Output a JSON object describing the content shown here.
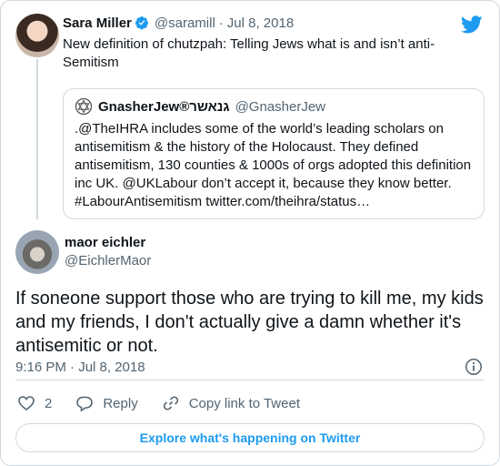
{
  "parent_tweet": {
    "author_name": "Sara Miller",
    "author_handle": "@saramill",
    "separator": "·",
    "date": "Jul 8, 2018",
    "text": "New definition of chutzpah: Telling Jews what is and isn’t anti-Semitism"
  },
  "quoted_tweet": {
    "author_name": "GnasherJew®גנאשר",
    "author_handle": "@GnasherJew",
    "text": ".@TheIHRA includes some of the world’s leading scholars on antisemitism & the history of the Holocaust. They defined antisemitism, 130 counties & 1000s of orgs adopted this definition inc UK. @UKLabour don’t accept it, because they know better. #LabourAntisemitism twitter.com/theihra/status…"
  },
  "main_tweet": {
    "author_name": "maor eichler",
    "author_handle": "@EichlerMaor",
    "text": "If soneone support those who are trying to kill me, my kids and my friends, I don't actually give a damn whether it's antisemitic or not.",
    "timestamp": "9:16 PM · Jul 8, 2018"
  },
  "actions": {
    "like_count": "2",
    "reply_label": "Reply",
    "copy_link_label": "Copy link to Tweet"
  },
  "explore_label": "Explore what's happening on Twitter",
  "colors": {
    "twitter_blue": "#1d9bf0",
    "secondary_text": "#536471",
    "border": "#cfd9de"
  }
}
